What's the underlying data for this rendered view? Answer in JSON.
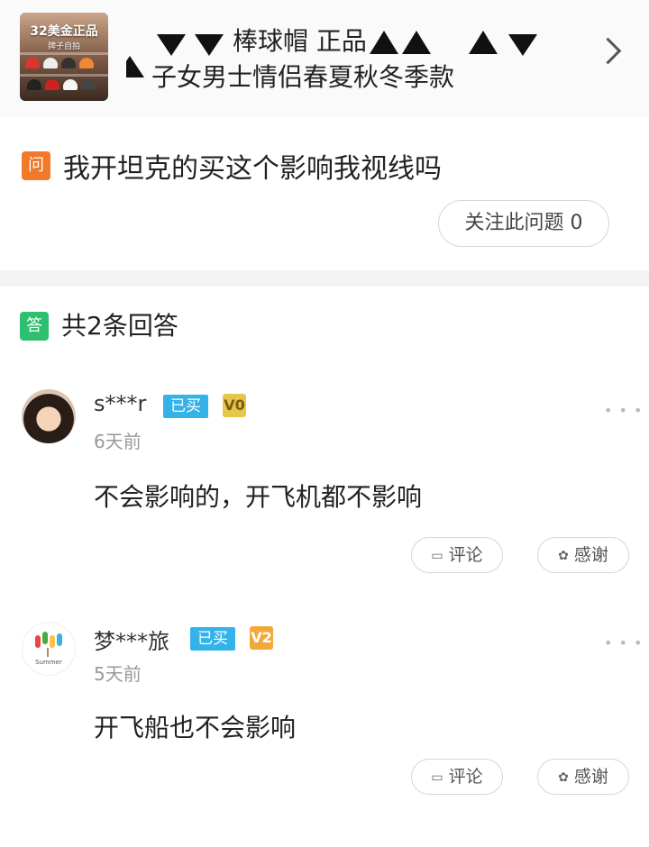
{
  "product": {
    "thumb_caption": "32美金正品",
    "thumb_sub": "牌子自拍",
    "title_line1": "棒球帽 正品",
    "title_line2": "子女男士情侣春夏秋冬季款"
  },
  "question": {
    "badge": "问",
    "text": "我开坦克的买这个影响我视线吗",
    "follow_label": "关注此问题 0"
  },
  "answers_header": {
    "badge": "答",
    "count_text": "共2条回答"
  },
  "answers": [
    {
      "username": "s***r",
      "bought_label": "已买",
      "level": "V0",
      "time_ago": "6天前",
      "content": "不会影响的，开飞机都不影响",
      "comment_label": "评论",
      "thanks_label": "感谢"
    },
    {
      "username": "梦***旅",
      "bought_label": "已买",
      "level": "V2",
      "time_ago": "5天前",
      "content": "开飞船也不会影响",
      "comment_label": "评论",
      "thanks_label": "感谢",
      "avatar_text": "Summer"
    }
  ],
  "colors": {
    "question_badge": "#f07a2a",
    "answer_badge": "#2fbf71",
    "bought_badge": "#34b3e8"
  }
}
